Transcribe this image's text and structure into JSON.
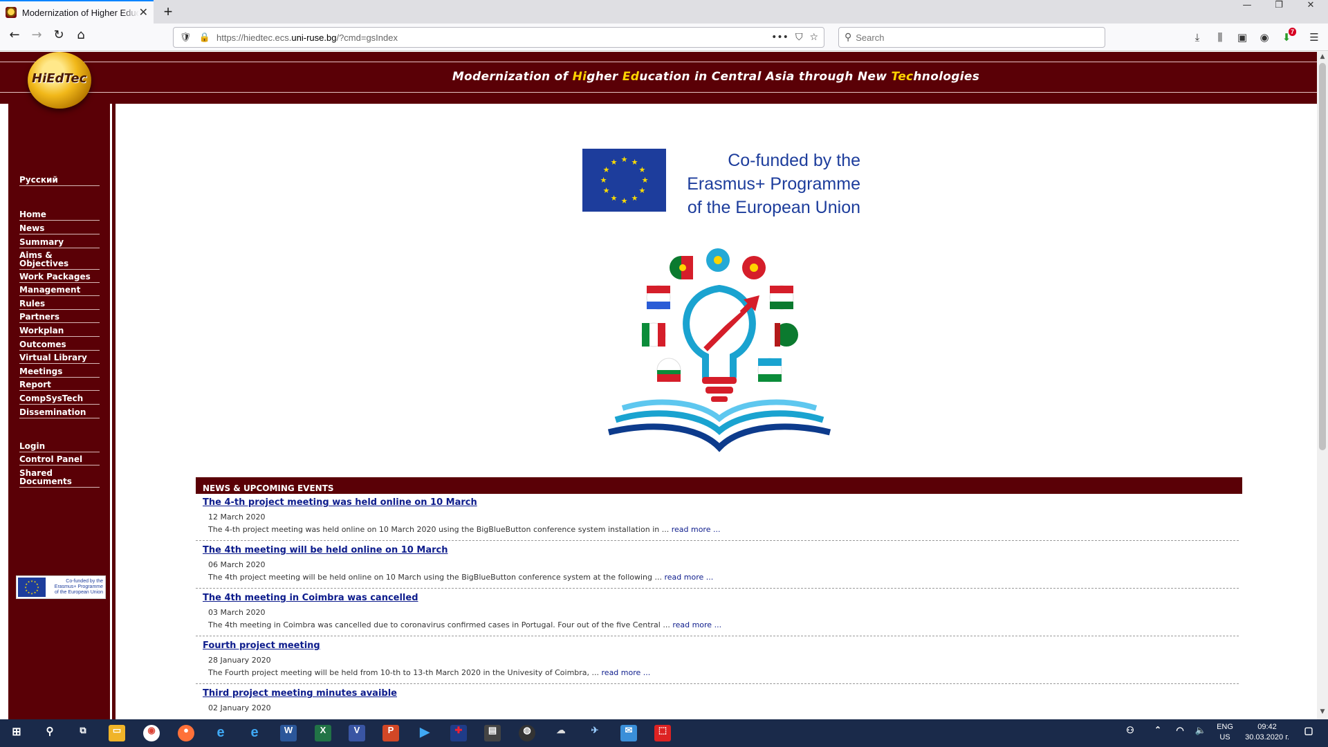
{
  "browser": {
    "tab_title": "Modernization of Higher Education in Central Asia",
    "tab_close": "✕",
    "new_tab": "+",
    "url_host": "https://hiedtec.ecs.",
    "url_domain": "uni-ruse.bg",
    "url_path": "/?cmd=gsIndex",
    "search_placeholder": "Search",
    "addon_badge": "7"
  },
  "site": {
    "logo_text": "HiEdTec",
    "header_title_parts": [
      {
        "text": "Modernization of ",
        "hl": false
      },
      {
        "text": "Hi",
        "hl": true
      },
      {
        "text": "gher ",
        "hl": false
      },
      {
        "text": "Ed",
        "hl": true
      },
      {
        "text": "ucation in Central Asia through New ",
        "hl": false
      },
      {
        "text": "Tec",
        "hl": true
      },
      {
        "text": "hnologies",
        "hl": false
      }
    ],
    "colors": {
      "brand": "#5a0006",
      "highlight": "#ffd400",
      "eu_blue": "#1d3d9c",
      "link": "#0d1c8c"
    }
  },
  "sidebar": {
    "language": "Русский",
    "nav": [
      "Home",
      "News",
      "Summary",
      "Aims & Objectives",
      "Work Packages",
      "Management",
      "Rules",
      "Partners",
      "Workplan",
      "Outcomes",
      "Virtual Library",
      "Meetings",
      "Report",
      "CompSysTech",
      "Dissemination"
    ],
    "account": [
      "Login",
      "Control Panel",
      "Shared Documents"
    ],
    "eu_small_text": [
      "Co-funded by the",
      "Erasmus+ Programme",
      "of the European Union"
    ]
  },
  "eu_banner": {
    "lines": [
      "Co-funded by the",
      "Erasmus+ Programme",
      "of the European Union"
    ]
  },
  "news": {
    "heading": "NEWS & UPCOMING EVENTS",
    "read_more": "read more ...",
    "items": [
      {
        "title": "The 4-th project meeting was held online on 10 March",
        "date": "12 March 2020",
        "text": "The 4-th project meeting was held online on 10 March 2020 using the BigBlueButton conference system installation in ... "
      },
      {
        "title": "The 4th meeting will be held online on 10 March",
        "date": "06 March 2020",
        "text": "The 4th project meeting will be held online on 10 March using the BigBlueButton conference system at the following ... "
      },
      {
        "title": "The 4th meeting in Coimbra was cancelled",
        "date": "03 March 2020",
        "text": "The 4th meeting in Coimbra was cancelled due to coronavirus confirmed cases in Portugal. Four out of the five Central ... "
      },
      {
        "title": "Fourth project meeting",
        "date": "28 January 2020",
        "text": "The Fourth project meeting will be held from 10-th to 13-th March 2020 in the Univesity of Coimbra, ... "
      },
      {
        "title": "Third project meeting minutes avaible",
        "date": "02 January 2020",
        "text": ""
      }
    ]
  },
  "taskbar": {
    "lang_top": "ENG",
    "lang_bottom": "US",
    "time": "09:42",
    "date": "30.03.2020 г."
  }
}
